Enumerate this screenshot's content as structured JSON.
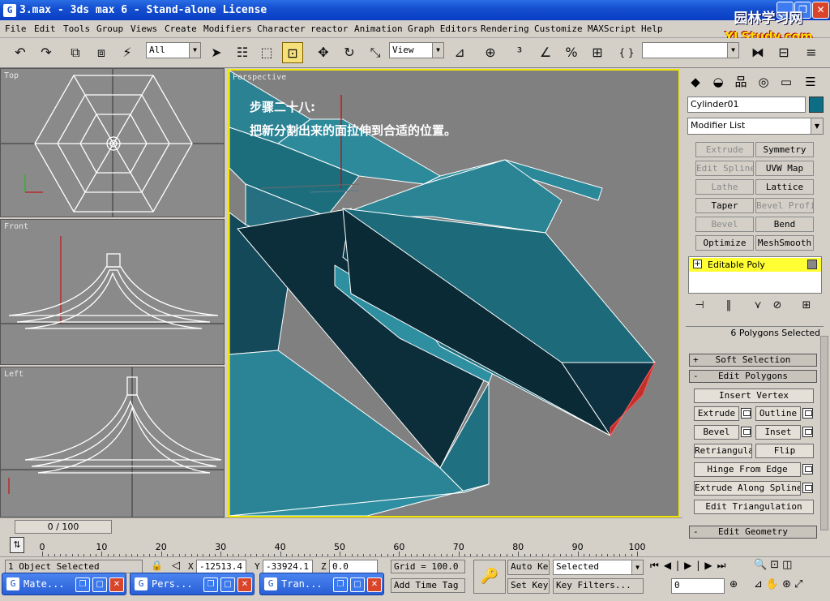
{
  "window": {
    "title": "3.max - 3ds max 6 - Stand-alone License",
    "icon": "G",
    "minimize_icon": "_",
    "restore_icon": "❐",
    "close_icon": "✕"
  },
  "watermark": {
    "line1": "园林学习网",
    "line2": "YLStudy.com"
  },
  "menu": [
    "File",
    "Edit",
    "Tools",
    "Group",
    "Views",
    "Create",
    "Modifiers",
    "Character",
    "reactor",
    "Animation",
    "Graph Editors",
    "Rendering",
    "Customize",
    "MAXScript",
    "Help"
  ],
  "toolbar": {
    "selection_filter": "All",
    "reference_coord": "View",
    "named_selection": "",
    "dropdown_arrow": "▼",
    "icons": {
      "undo": "↶",
      "redo": "↷",
      "link": "⧉",
      "unlink": "⧈",
      "bind": "⚡",
      "select": "➤",
      "select_by_name": "☷",
      "select_region": "⬚",
      "window_crossing": "⊡",
      "move": "✥",
      "rotate": "↻",
      "scale": "⤡",
      "manipulate": "⊿",
      "snap3": "³",
      "angle_snap": "∠",
      "percent_snap": "%",
      "spinner_snap": "⊕",
      "mirror": "⧓",
      "align": "⊟",
      "layers": "≡",
      "curly": "{ }",
      "named": "⊞",
      "mirror2": "◧",
      "align2": "◨"
    }
  },
  "viewports": {
    "top": {
      "label": "Top"
    },
    "front": {
      "label": "Front"
    },
    "left": {
      "label": "Left"
    },
    "perspective": {
      "label": "Perspective"
    }
  },
  "annotation": {
    "step": "步骤二十八:",
    "text": "把新分割出来的面拉伸到合适的位置。"
  },
  "command_panel": {
    "object_name": "Cylinder01",
    "object_color": "#0b6e84",
    "modifier_list": "Modifier List",
    "modifier_buttons": [
      {
        "label": "Extrude",
        "enabled": false
      },
      {
        "label": "Symmetry",
        "enabled": true
      },
      {
        "label": "Edit Spline",
        "enabled": false
      },
      {
        "label": "UVW Map",
        "enabled": true
      },
      {
        "label": "Lathe",
        "enabled": false
      },
      {
        "label": "Lattice",
        "enabled": true
      },
      {
        "label": "Taper",
        "enabled": true
      },
      {
        "label": "Bevel Profile",
        "enabled": false
      },
      {
        "label": "Bevel",
        "enabled": false
      },
      {
        "label": "Bend",
        "enabled": true
      },
      {
        "label": "Optimize",
        "enabled": true
      },
      {
        "label": "MeshSmooth",
        "enabled": true
      }
    ],
    "stack_item": "Editable Poly",
    "stack_expand": "+",
    "stack_icons": {
      "pin": "⊣",
      "show_end": "‖",
      "unique": "⋎",
      "remove": "⊘",
      "configure": "⊞"
    },
    "selection_info": "6 Polygons Selected",
    "rollouts": {
      "soft_selection": {
        "sign": "+",
        "label": "Soft Selection"
      },
      "edit_polygons": {
        "sign": "-",
        "label": "Edit Polygons"
      },
      "edit_geometry": {
        "sign": "-",
        "label": "Edit Geometry"
      }
    },
    "polygon_buttons": {
      "insert_vertex": "Insert Vertex",
      "extrude": "Extrude",
      "outline": "Outline",
      "bevel": "Bevel",
      "inset": "Inset",
      "retriangulate": "Retriangulate",
      "flip": "Flip",
      "hinge": "Hinge From Edge",
      "extrude_spline": "Extrude Along Spline",
      "edit_tri": "Edit Triangulation"
    },
    "tab_icons": {
      "create": "◆",
      "modify": "◒",
      "hierarchy": "品",
      "motion": "◎",
      "display": "▭",
      "utilities": "☰"
    }
  },
  "timeline": {
    "frame_display": "0 / 100",
    "ticks": [
      "0",
      "10",
      "20",
      "30",
      "40",
      "50",
      "60",
      "70",
      "80",
      "90",
      "100"
    ],
    "key_icon": "⇅"
  },
  "status": {
    "selection": "1 Object Selected",
    "lock_icon": "🔒",
    "abs_icon": "◁",
    "x_label": "X",
    "x_value": "-12513.4",
    "y_label": "Y",
    "y_value": "-33924.1",
    "z_label": "Z",
    "z_value": "0.0",
    "grid": "Grid = 100.0",
    "add_time_tag": "Add Time Tag",
    "key_icon": "🔑",
    "auto_key": "Auto Key",
    "set_key": "Set Key",
    "key_mode": "Selected",
    "key_filters": "Key Filters...",
    "frame": "0",
    "playback_icons": [
      "⏮",
      "◀|",
      "▶",
      "|▶",
      "⏭"
    ],
    "nav_icons": [
      "🔍",
      "⊕",
      "⊡",
      "◫",
      "⊿",
      "▷",
      "✋",
      "⊛",
      "⤢"
    ]
  },
  "taskbar": [
    {
      "label": "Mate...",
      "icon": "G",
      "min": "❐",
      "max": "□",
      "close": "✕"
    },
    {
      "label": "Pers...",
      "icon": "G",
      "min": "❐",
      "max": "□",
      "close": "✕"
    },
    {
      "label": "Tran...",
      "icon": "G",
      "min": "❐",
      "max": "□",
      "close": "✕"
    }
  ]
}
